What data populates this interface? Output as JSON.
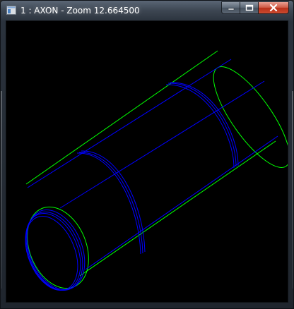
{
  "window": {
    "title": "1 : AXON - Zoom 12.664500",
    "icons": {
      "app": "app-window-icon",
      "minimize": "minimize-icon",
      "maximize": "maximize-icon",
      "close": "close-icon"
    }
  },
  "viewport": {
    "background": "#000000",
    "colors": {
      "outline": "#00ff00",
      "edges": "#0000ff"
    }
  }
}
